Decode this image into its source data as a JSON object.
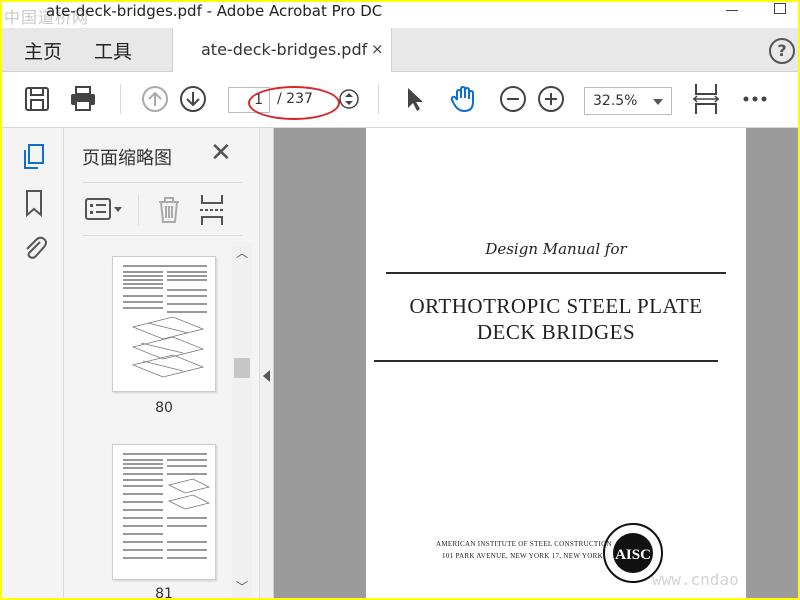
{
  "window": {
    "title": "ate-deck-bridges.pdf - Adobe Acrobat Pro DC",
    "watermark_top": "中国道桥网",
    "watermark_bottom": "www.cndao"
  },
  "tabs": {
    "home": "主页",
    "tools": "工具",
    "document": "ate-deck-bridges.pdf",
    "close": "×",
    "help": "?"
  },
  "toolbar": {
    "page_current": "1",
    "page_total": "/ 237",
    "zoom": "32.5%"
  },
  "thumbnail_panel": {
    "title": "页面缩略图",
    "pages": [
      {
        "label": "80"
      },
      {
        "label": "81"
      }
    ]
  },
  "document_page": {
    "subtitle": "Design Manual for",
    "title_line1": "ORTHOTROPIC STEEL PLATE",
    "title_line2": "DECK BRIDGES",
    "publisher_line1": "AMERICAN INSTITUTE OF STEEL CONSTRUCTION",
    "publisher_line2": "101 PARK AVENUE, NEW YORK 17, NEW YORK",
    "seal_text": "AISC"
  },
  "colors": {
    "accent": "#0e6fd1",
    "annotation_red": "#d9262b",
    "border_yellow": "#ffff00"
  }
}
